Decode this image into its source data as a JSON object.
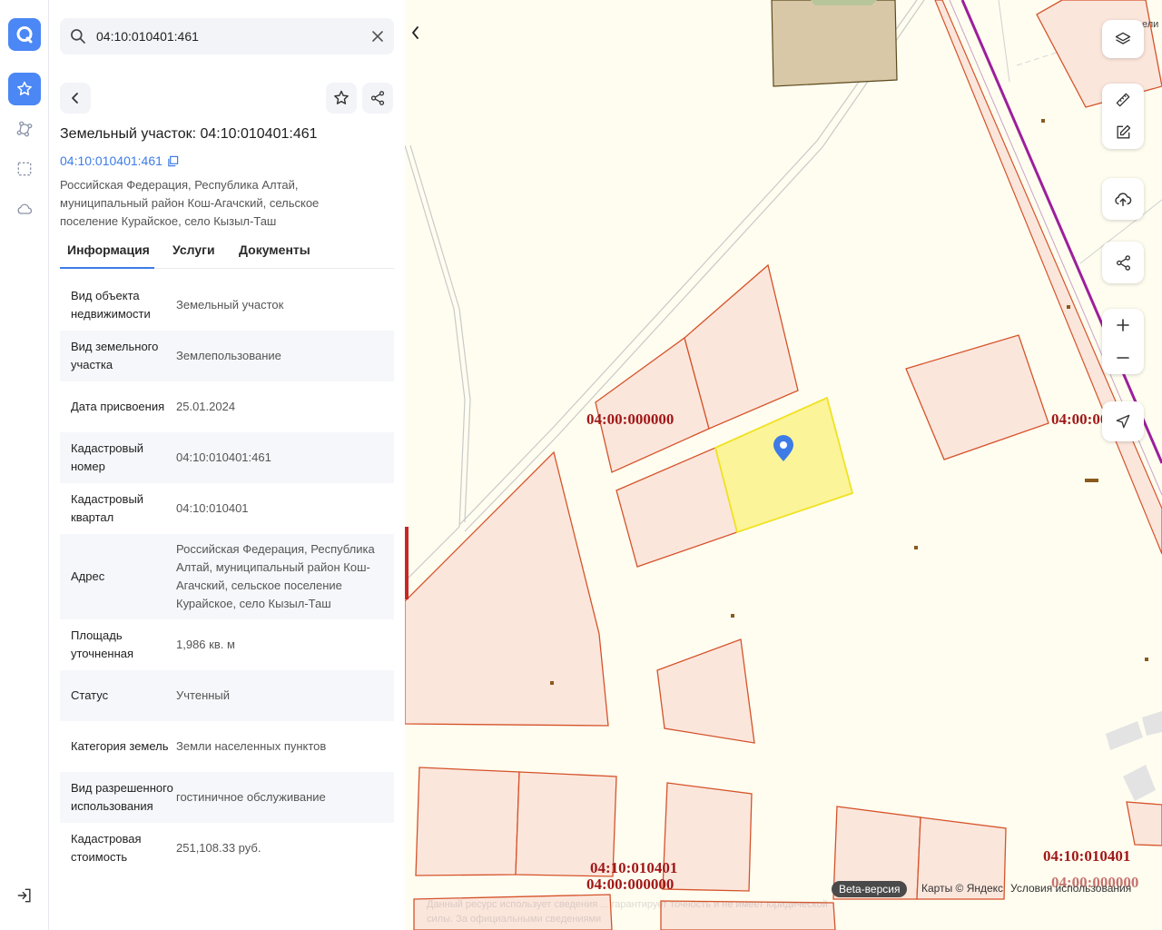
{
  "search": {
    "value": "04:10:010401:461"
  },
  "object": {
    "title": "Земельный участок: 04:10:010401:461",
    "cadastral_link": "04:10:010401:461",
    "address": "Российская Федерация, Республика Алтай, муниципальный район Кош-Агачский, сельское поселение Курайское, село Кызыл-Таш"
  },
  "tabs": [
    {
      "label": "Информация"
    },
    {
      "label": "Услуги"
    },
    {
      "label": "Документы"
    }
  ],
  "info_rows": [
    {
      "key": "Вид объекта недвижимости",
      "value": "Земельный участок"
    },
    {
      "key": "Вид земельного участка",
      "value": "Землепользование"
    },
    {
      "key": "Дата присвоения",
      "value": "25.01.2024"
    },
    {
      "key": "Кадастровый номер",
      "value": "04:10:010401:461"
    },
    {
      "key": "Кадастровый квартал",
      "value": "04:10:010401"
    },
    {
      "key": "Адрес",
      "value": "Российская Федерация, Республика Алтай, муниципальный район Кош-Агачский, сельское поселение Курайское, село Кызыл-Таш"
    },
    {
      "key": "Площадь уточненная",
      "value": "1,986 кв. м"
    },
    {
      "key": "Статус",
      "value": "Учтенный"
    },
    {
      "key": "Категория земель",
      "value": "Земли населенных пунктов"
    },
    {
      "key": "Вид разрешенного использования",
      "value": "гостиничное обслуживание"
    },
    {
      "key": "Кадастровая стоимость",
      "value": "251,108.33 руб."
    }
  ],
  "map": {
    "labels": {
      "zone_left": "04:00:000000",
      "zone_right": "04:00:000000",
      "quarter_bottom": "04:10:010401",
      "zone_bottom": "04:00:000000",
      "quarter_bottom_right": "04:10:010401",
      "zone_bottom_right": "04:00:000000",
      "street_fragment": "ели"
    },
    "beta_badge": "Beta-версия",
    "attribution": "Карты © Яндекс",
    "terms": "Условия использования",
    "disclaimer": "Данный ресурс использует сведения ... гарантирует точность и не имеет юридической силы. За официальными сведениями"
  },
  "colors": {
    "accent": "#4b87f5",
    "parcel_fill": "#fbe6dc",
    "parcel_stroke": "#d5532a",
    "selected_fill": "#fbf28a",
    "selected_stroke": "#f0e222",
    "label_red": "#a01818",
    "road_purple": "#9c1f9c"
  }
}
